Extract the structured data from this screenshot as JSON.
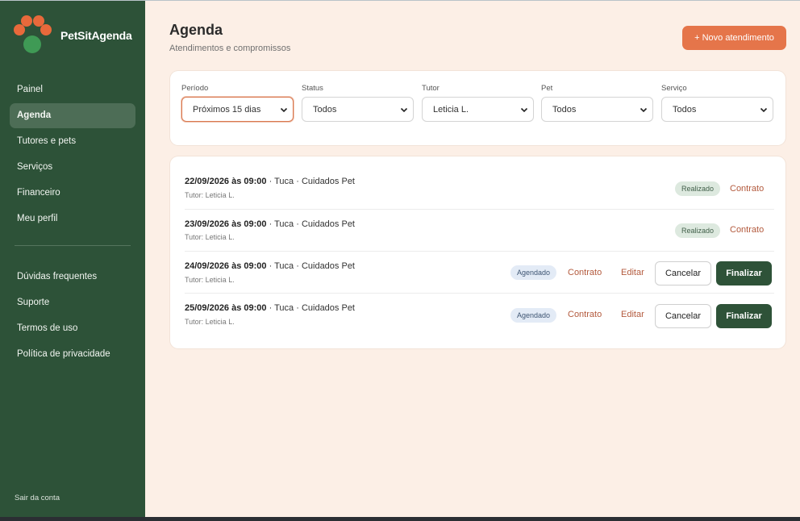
{
  "app": {
    "name": "PetSitAgenda"
  },
  "sidebar": {
    "main_items": [
      {
        "label": "Painel"
      },
      {
        "label": "Agenda"
      },
      {
        "label": "Tutores e pets"
      },
      {
        "label": "Serviços"
      },
      {
        "label": "Financeiro"
      },
      {
        "label": "Meu perfil"
      }
    ],
    "help_items": [
      {
        "label": "Dúvidas frequentes"
      },
      {
        "label": "Suporte"
      },
      {
        "label": "Termos de uso"
      },
      {
        "label": "Política de privacidade"
      }
    ],
    "logout_label": "Sair da conta"
  },
  "header": {
    "title": "Agenda",
    "subtitle": "Atendimentos e compromissos",
    "new_button": "+ Novo atendimento"
  },
  "filters": [
    {
      "label": "Período",
      "value": "Próximos 15 dias"
    },
    {
      "label": "Status",
      "value": "Todos"
    },
    {
      "label": "Tutor",
      "value": "Leticia L."
    },
    {
      "label": "Pet",
      "value": "Todos"
    },
    {
      "label": "Serviço",
      "value": "Todos"
    }
  ],
  "appointments": [
    {
      "datetime": "22/09/2026 às 09:00",
      "details": " · Tuca · Cuidados Pet",
      "tutor": "Tutor: Leticia L.",
      "status": "Realizado",
      "contract": "Contrato"
    },
    {
      "datetime": "23/09/2026 às 09:00",
      "details": " · Tuca · Cuidados Pet",
      "tutor": "Tutor: Leticia L.",
      "status": "Realizado",
      "contract": "Contrato"
    },
    {
      "datetime": "24/09/2026 às 09:00",
      "details": " · Tuca · Cuidados Pet",
      "tutor": "Tutor: Leticia L.",
      "status": "Agendado",
      "contract": "Contrato",
      "edit": "Editar",
      "cancel": "Cancelar",
      "finish": "Finalizar"
    },
    {
      "datetime": "25/09/2026 às 09:00",
      "details": " · Tuca · Cuidados Pet",
      "tutor": "Tutor: Leticia L.",
      "status": "Agendado",
      "contract": "Contrato",
      "edit": "Editar",
      "cancel": "Cancelar",
      "finish": "Finalizar"
    }
  ],
  "colors": {
    "sidebar": "#2d5238",
    "accent": "#e5754a",
    "background": "#fcefe6",
    "primary_button": "#2e5238"
  }
}
